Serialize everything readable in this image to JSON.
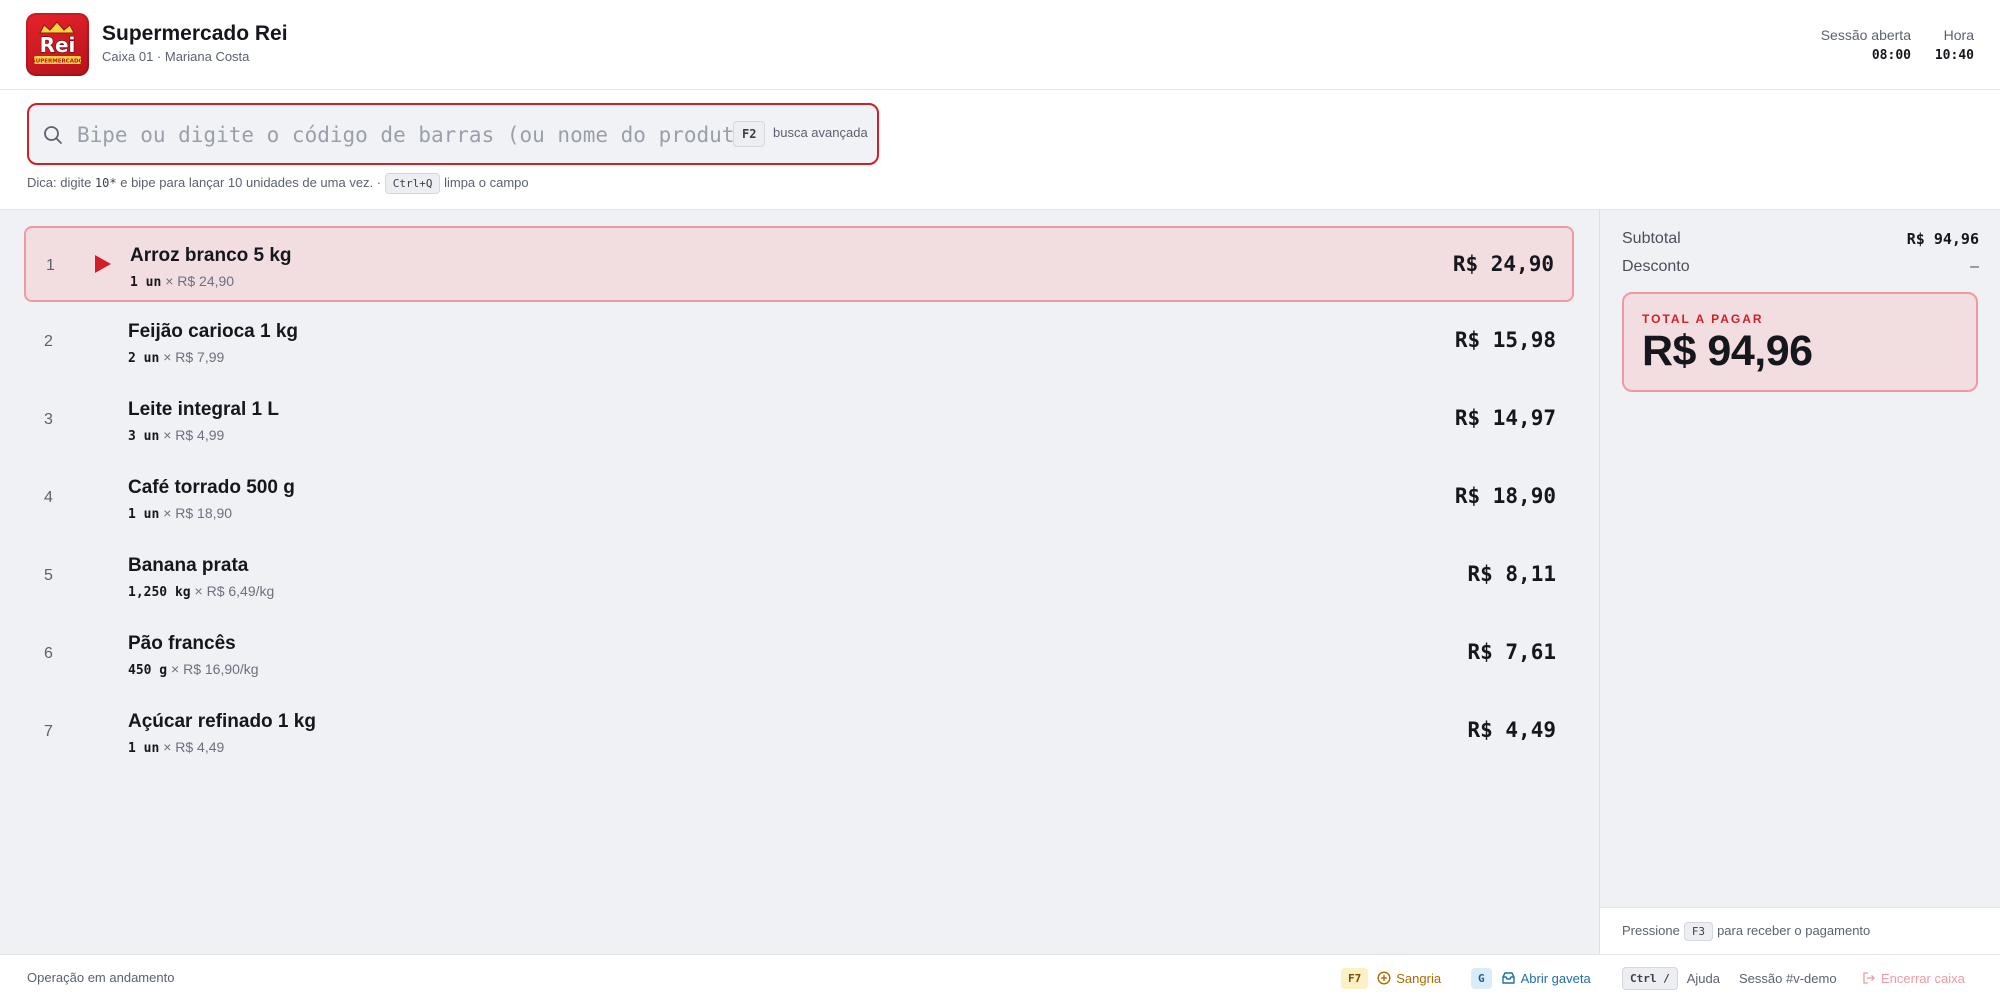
{
  "header": {
    "store_name": "Supermercado Rei",
    "register_info": "Caixa 01 · Mariana Costa",
    "session_label": "Sessão aberta",
    "session_value": "08:00",
    "time_label": "Hora",
    "time_value": "10:40",
    "logo_text": "Rei",
    "logo_subtext": "SUPERMERCADO"
  },
  "search": {
    "placeholder": "Bipe ou digite o código de barras (ou nome do produto)",
    "value": "",
    "shortcut_key": "F2",
    "shortcut_label": "busca avançada",
    "tip_prefix": "Dica: digite ",
    "tip_code": "10*",
    "tip_middle": " e bipe para lançar 10 unidades de uma vez. · ",
    "tip_key": "Ctrl+Q",
    "tip_suffix": " limpa o campo"
  },
  "items": [
    {
      "index": "1",
      "name": "Arroz branco 5 kg",
      "qty": "1 un",
      "unit_price": "× R$ 24,90",
      "total": "R$ 24,90",
      "selected": true
    },
    {
      "index": "2",
      "name": "Feijão carioca 1 kg",
      "qty": "2 un",
      "unit_price": "× R$ 7,99",
      "total": "R$ 15,98",
      "selected": false
    },
    {
      "index": "3",
      "name": "Leite integral 1 L",
      "qty": "3 un",
      "unit_price": "× R$ 4,99",
      "total": "R$ 14,97",
      "selected": false
    },
    {
      "index": "4",
      "name": "Café torrado 500 g",
      "qty": "1 un",
      "unit_price": "× R$ 18,90",
      "total": "R$ 18,90",
      "selected": false
    },
    {
      "index": "5",
      "name": "Banana prata",
      "qty": "1,250 kg",
      "unit_price": "× R$ 6,49/kg",
      "total": "R$ 8,11",
      "selected": false
    },
    {
      "index": "6",
      "name": "Pão francês",
      "qty": "450 g",
      "unit_price": "× R$ 16,90/kg",
      "total": "R$ 7,61",
      "selected": false
    },
    {
      "index": "7",
      "name": "Açúcar refinado 1 kg",
      "qty": "1 un",
      "unit_price": "× R$ 4,49",
      "total": "R$ 4,49",
      "selected": false
    }
  ],
  "summary": {
    "subtotal_label": "Subtotal",
    "subtotal_value": "R$ 94,96",
    "discount_label": "Desconto",
    "discount_value": "–",
    "total_label": "TOTAL A PAGAR",
    "total_value": "R$ 94,96",
    "pay_prefix": "Pressione",
    "pay_key": "F3",
    "pay_suffix": "para receber o pagamento"
  },
  "footer": {
    "status": "Operação em andamento",
    "sangria_key": "F7",
    "sangria_label": "Sangria",
    "drawer_key": "G",
    "drawer_label": "Abrir gaveta",
    "help_key": "Ctrl /",
    "help_label": "Ajuda",
    "session_id": "Sessão #v-demo",
    "close_label": "Encerrar caixa"
  },
  "colors": {
    "accent": "#cf1f27",
    "selected_bg": "#f2dde0",
    "selected_border": "#ef9aa3",
    "sangria": "#b06a00",
    "drawer": "#1f6fa8",
    "close_disabled": "#ef9aa3"
  },
  "icons": [
    "search-icon",
    "play-arrow-icon",
    "coin-icon",
    "drawer-icon",
    "logout-icon"
  ]
}
